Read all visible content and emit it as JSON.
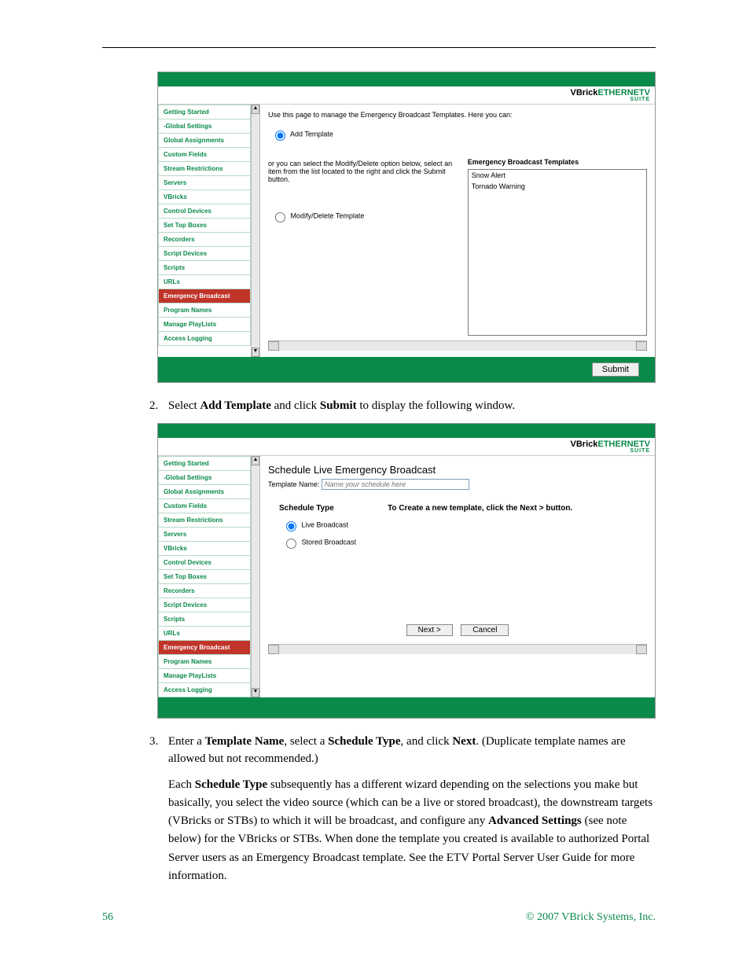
{
  "logo": {
    "brand": "VBrick",
    "product": "ETHERNETV",
    "suite": "SUITE"
  },
  "sidebar": [
    "Getting Started",
    "-Global Settings",
    "Global Assignments",
    "Custom Fields",
    "Stream Restrictions",
    "Servers",
    "VBricks",
    "Control Devices",
    "Set Top Boxes",
    "Recorders",
    "Script Devices",
    "Scripts",
    "URLs",
    "Emergency Broadcast",
    "Program Names",
    "Manage PlayLists",
    "Access Logging"
  ],
  "sidebar_selected_index": 13,
  "screenshot1": {
    "intro": "Use this page to manage the Emergency Broadcast Templates. Here you can:",
    "opt_add": "Add Template",
    "middle_text": "or you can select the Modify/Delete option below, select an item from the list located to the right and click the Submit button.",
    "opt_mod": "Modify/Delete Template",
    "list_header": "Emergency Broadcast Templates",
    "list_items": [
      "Snow Alert",
      "Tornado Warning"
    ],
    "submit": "Submit"
  },
  "step2": {
    "num": "2.",
    "a": "Select ",
    "b_bold": "Add Template",
    "c": " and click ",
    "d_bold": "Submit",
    "e": " to display the following window."
  },
  "screenshot2": {
    "title": "Schedule Live Emergency Broadcast",
    "tname_label": "Template Name:",
    "tname_placeholder": "Name your schedule here",
    "sched_title": "Schedule Type",
    "opt_live": "Live Broadcast",
    "opt_stored": "Stored Broadcast",
    "hint": "To Create a new template, click the Next > button.",
    "btn_next": "Next >",
    "btn_cancel": "Cancel"
  },
  "step3": {
    "num": "3.",
    "a": "Enter a ",
    "b_bold": "Template Name",
    "c": ", select a ",
    "d_bold": "Schedule Type",
    "e": ", and click ",
    "f_bold": "Next",
    "g": ". (Duplicate template names are allowed but not recommended.)"
  },
  "para1": {
    "a": "Each ",
    "b_bold": "Schedule Type",
    "c": " subsequently has a different wizard depending on the selections you make but basically, you select the video source (which can be a live or stored broadcast), the downstream targets (VBricks or STBs) to which it will be broadcast, and configure any ",
    "d_bold": "Advanced Settings",
    "e": " (see note below) for the VBricks or STBs. When done the template you created is available to authorized Portal Server users as an Emergency Broadcast template. See the ",
    "f_ital": "ETV Portal Server User Guide",
    "g": " for more information."
  },
  "footer": {
    "page": "56",
    "copy": "© 2007 VBrick Systems, Inc."
  }
}
